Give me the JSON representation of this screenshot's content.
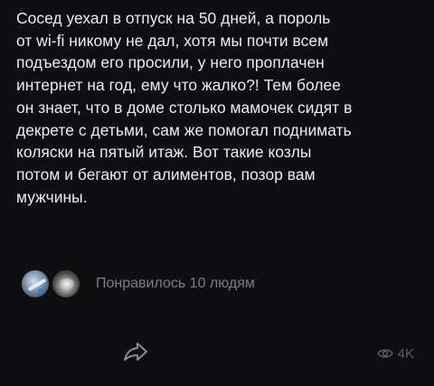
{
  "post": {
    "text_lines": [
      "Сосед уехал в отпуск на 50 дней, а пороль",
      "от wi-fi никому не дал, хотя мы почти всем",
      "подъездом его просили, у него проплачен",
      "интернет на год, ему что жалко?! Тем более",
      "он знает, что в доме столько мамочек сидят в",
      "декрете с детьми, сам же помогал поднимать",
      "коляски на пятый итаж. Вот такие козлы",
      "потом и бегают от алиментов, позор вам",
      "мужчины."
    ],
    "likes_text": "Понравилось 10 людям",
    "views_count": "4K"
  },
  "icons": {
    "share": "share-arrow-icon",
    "views": "eye-icon"
  },
  "colors": {
    "background": "#0f0f11",
    "text": "#ececee",
    "muted": "#7c7d82"
  }
}
